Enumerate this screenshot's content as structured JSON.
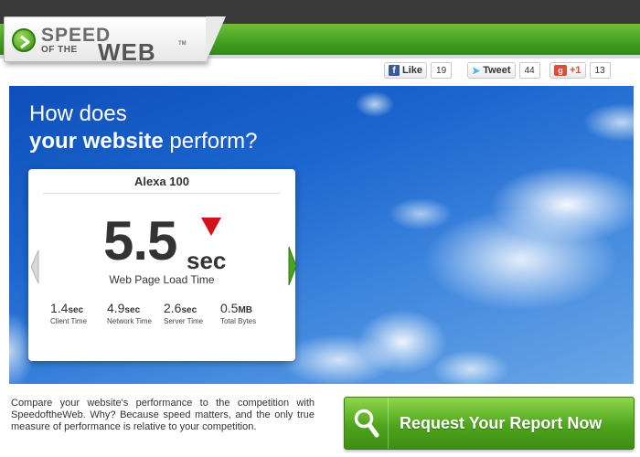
{
  "brand": {
    "logo_speed": "SPEED",
    "logo_ofthe": "OF THE",
    "logo_web": "WEB",
    "logo_tm": "TM"
  },
  "social": {
    "facebook_label": "Like",
    "facebook_count": "19",
    "twitter_label": "Tweet",
    "twitter_count": "44",
    "gplus_label": "+1",
    "gplus_count": "13"
  },
  "hero": {
    "headline_line1": "How does",
    "headline_bold": "your website",
    "headline_rest": " perform?"
  },
  "card": {
    "title": "Alexa 100",
    "load_time_value": "5.5",
    "load_time_unit": "sec",
    "load_time_label": "Web Page Load Time",
    "trend": "down",
    "metrics": [
      {
        "value": "1.4",
        "unit": "sec",
        "label": "Client Time"
      },
      {
        "value": "4.9",
        "unit": "sec",
        "label": "Network Time"
      },
      {
        "value": "2.6",
        "unit": "sec",
        "label": "Server Time"
      },
      {
        "value": "0.5",
        "unit": "MB",
        "label": "Total Bytes"
      }
    ]
  },
  "blurb": "Compare your website's performance to the competition with SpeedoftheWeb. Why? Because speed matters, and the only true measure of performance is relative to your competition.",
  "cta": {
    "label": "Request Your Report Now",
    "icon": "search-icon"
  },
  "colors": {
    "brand_green": "#4aa21f",
    "trend_red": "#d0121b",
    "sky_blue": "#1c66cf"
  }
}
